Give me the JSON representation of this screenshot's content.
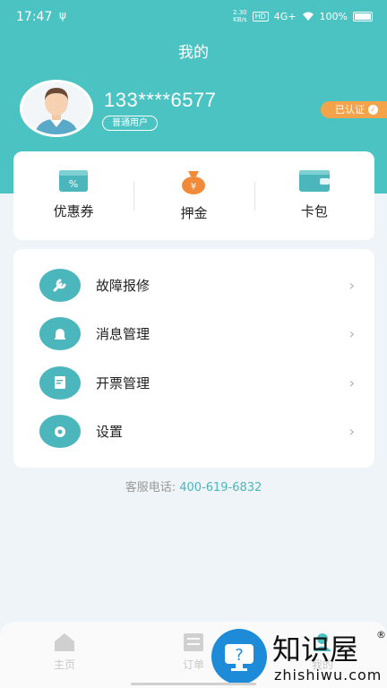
{
  "status_bar": {
    "time": "17:47",
    "usb": "ψ",
    "speed": "2.30\nKB/s",
    "hd": "HD",
    "network": "4G+",
    "battery": "100%"
  },
  "header": {
    "title": "我的"
  },
  "profile": {
    "phone": "133****6577",
    "user_type": "普通用户",
    "verified": "已认证",
    "avatar_icon": "user-avatar"
  },
  "quick_actions": [
    {
      "label": "优惠券",
      "icon": "coupon-icon",
      "color": "#4bb7bc"
    },
    {
      "label": "押金",
      "icon": "money-bag-icon",
      "color": "#f08b3a"
    },
    {
      "label": "卡包",
      "icon": "wallet-icon",
      "color": "#4bb7bc"
    }
  ],
  "menu": [
    {
      "label": "故障报修",
      "icon": "wrench-icon"
    },
    {
      "label": "消息管理",
      "icon": "bell-icon"
    },
    {
      "label": "开票管理",
      "icon": "invoice-icon"
    },
    {
      "label": "设置",
      "icon": "gear-icon"
    }
  ],
  "hotline": {
    "label": "客服电话: ",
    "number": "400-619-6832"
  },
  "tabs": [
    {
      "label": "主页",
      "icon": "home-icon"
    },
    {
      "label": "订单",
      "icon": "order-icon"
    },
    {
      "label": "我的",
      "icon": "profile-icon"
    }
  ],
  "watermark": {
    "cn": "知识屋",
    "en": "zhishiwu.com",
    "reg": "®"
  },
  "colors": {
    "accent": "#4bc3c3",
    "menu_icon": "#4bb7bc",
    "badge": "#f3a34a"
  }
}
